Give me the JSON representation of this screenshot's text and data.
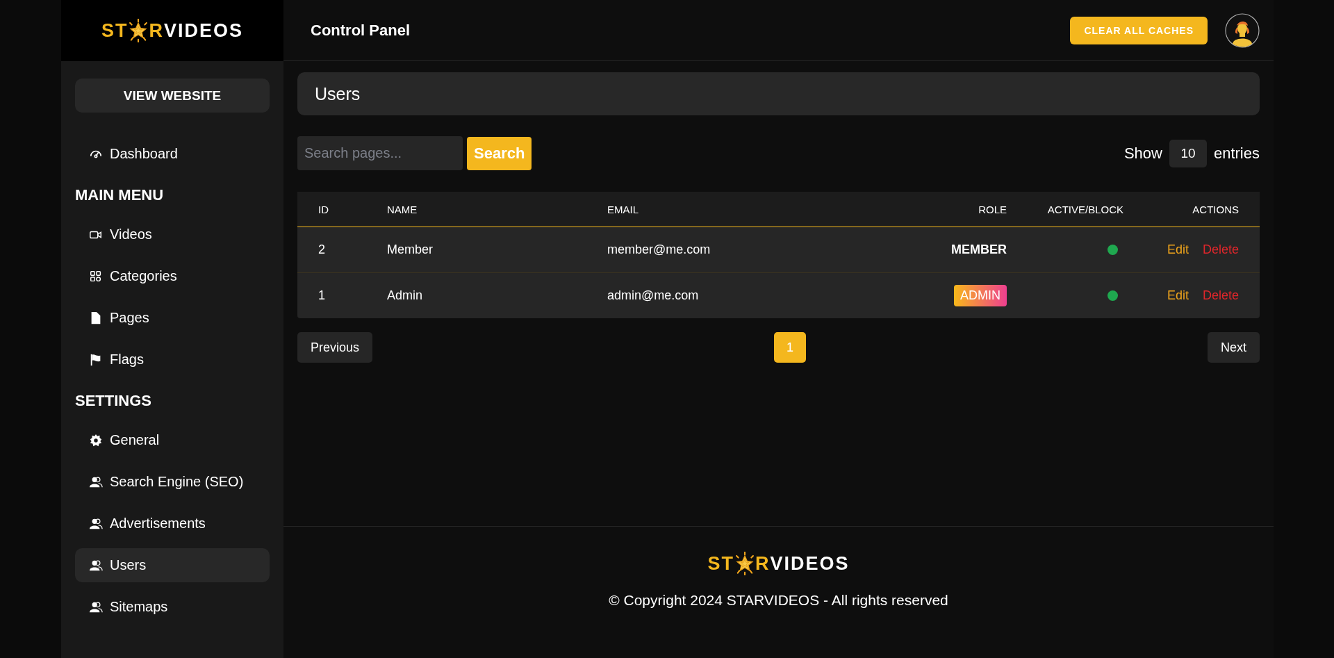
{
  "sidebar": {
    "logo": {
      "before": "ST",
      "after": "R",
      "rest": "VIDEOS"
    },
    "view_website": "VIEW WEBSITE",
    "top_items": [
      {
        "label": "Dashboard",
        "selected": false
      }
    ],
    "sections": [
      {
        "title": "MAIN MENU",
        "items": [
          {
            "label": "Videos",
            "selected": false
          },
          {
            "label": "Categories",
            "selected": false
          },
          {
            "label": "Pages",
            "selected": false
          },
          {
            "label": "Flags",
            "selected": false
          }
        ]
      },
      {
        "title": "SETTINGS",
        "items": [
          {
            "label": "General",
            "selected": false
          },
          {
            "label": "Search Engine (SEO)",
            "selected": false
          },
          {
            "label": "Advertisements",
            "selected": false
          },
          {
            "label": "Users",
            "selected": true
          },
          {
            "label": "Sitemaps",
            "selected": false
          }
        ]
      }
    ]
  },
  "header": {
    "title": "Control Panel",
    "clear_caches": "CLEAR ALL CACHES"
  },
  "page_title": "Users",
  "search": {
    "placeholder": "Search pages...",
    "button": "Search"
  },
  "entries": {
    "show": "Show",
    "value": "10",
    "suffix": "entries"
  },
  "table": {
    "columns": [
      "ID",
      "NAME",
      "EMAIL",
      "ROLE",
      "ACTIVE/BLOCK",
      "ACTIONS"
    ],
    "rows": [
      {
        "id": "2",
        "name": "Member",
        "email": "member@me.com",
        "role": {
          "text": "MEMBER",
          "kind": "plain"
        },
        "active": true,
        "edit": "Edit",
        "delete": "Delete"
      },
      {
        "id": "1",
        "name": "Admin",
        "email": "admin@me.com",
        "role": {
          "text": "ADMIN",
          "kind": "badge"
        },
        "active": true,
        "edit": "Edit",
        "delete": "Delete"
      }
    ]
  },
  "pagination": {
    "previous": "Previous",
    "pages": [
      {
        "label": "1",
        "selected": true
      }
    ],
    "next": "Next"
  },
  "footer": {
    "logo": {
      "before": "ST",
      "after": "R",
      "rest": "VIDEOS"
    },
    "copyright": "© Copyright 2024 STARVIDEOS - All rights reserved"
  }
}
